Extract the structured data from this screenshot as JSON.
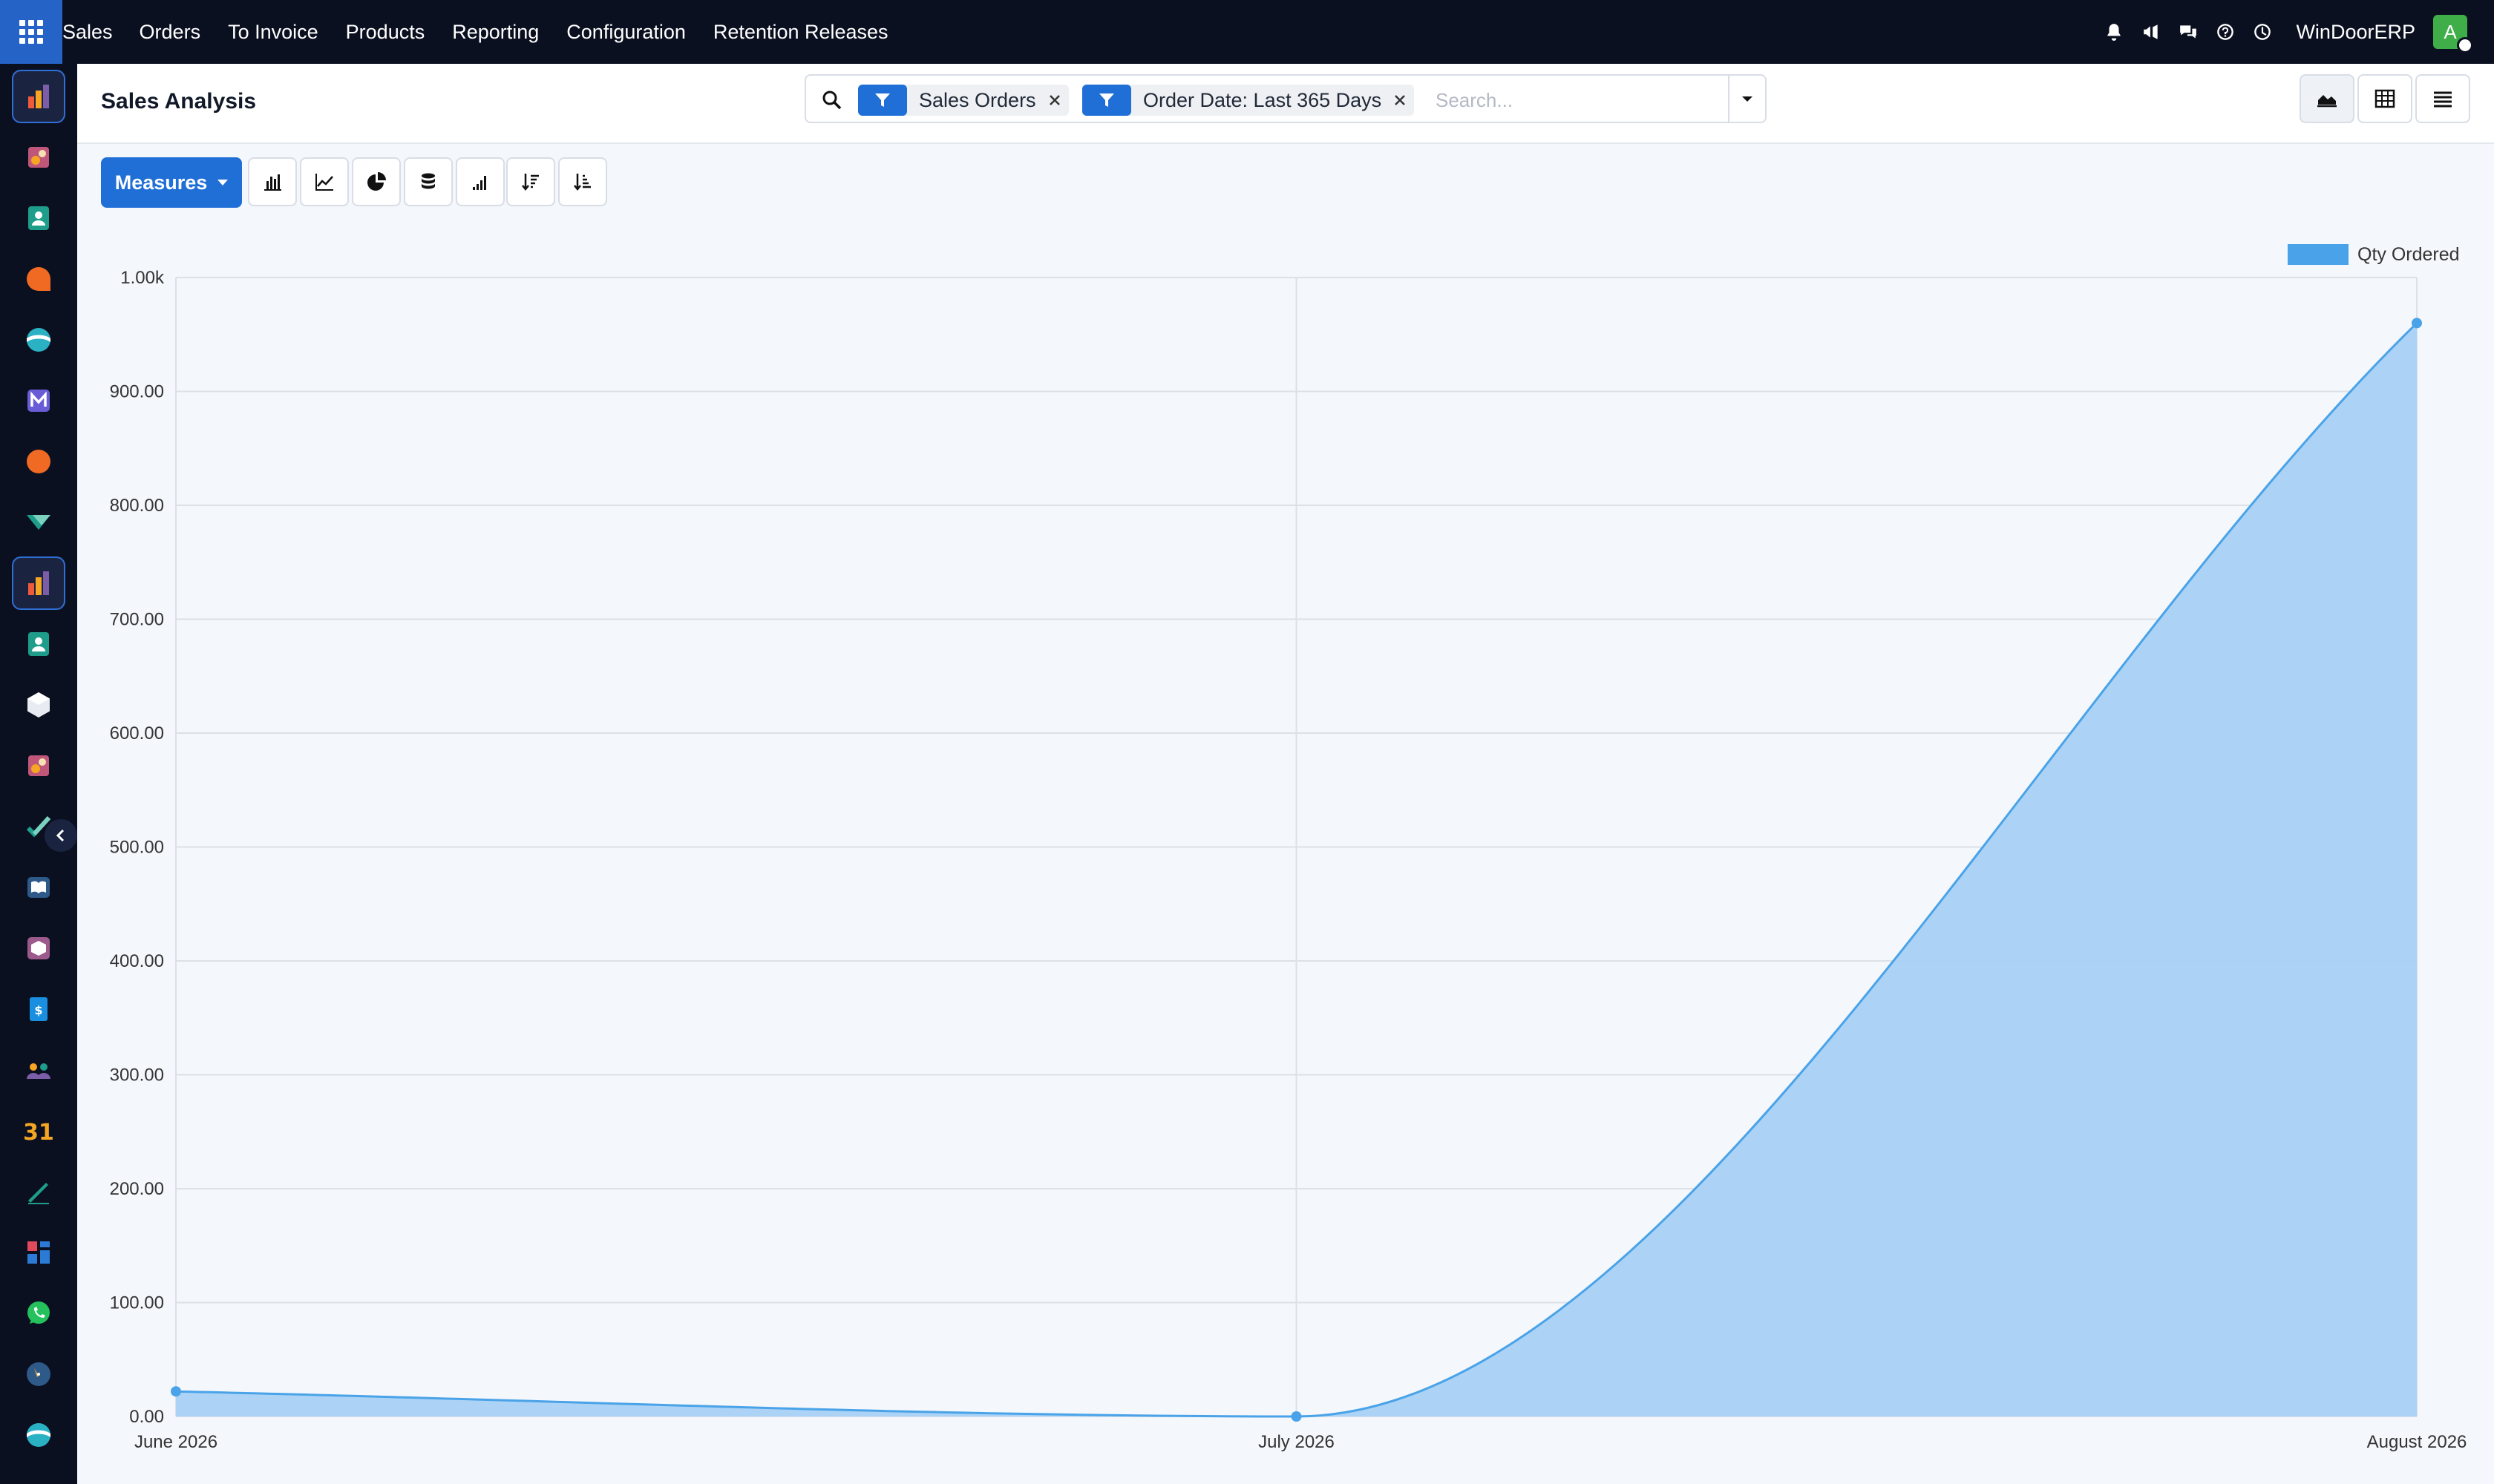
{
  "navbar": {
    "menu": [
      "Sales",
      "Orders",
      "To Invoice",
      "Products",
      "Reporting",
      "Configuration",
      "Retention Releases"
    ],
    "company": "WinDoorERP",
    "avatar_initial": "A"
  },
  "dock": {
    "apps": [
      {
        "icon": "sales-icon",
        "active": true
      },
      {
        "icon": "crm-icon"
      },
      {
        "icon": "contacts-icon"
      },
      {
        "icon": "discuss-icon"
      },
      {
        "icon": "website-icon"
      },
      {
        "icon": "email-marketing-icon"
      },
      {
        "icon": "live-chat-icon"
      },
      {
        "icon": "helpdesk-icon"
      },
      {
        "icon": "sales-icon",
        "active": true
      },
      {
        "icon": "contacts-icon"
      },
      {
        "icon": "inventory-icon"
      },
      {
        "icon": "crm-icon"
      },
      {
        "icon": "project-icon"
      },
      {
        "icon": "knowledge-icon"
      },
      {
        "icon": "purchase-icon"
      },
      {
        "icon": "invoicing-icon"
      },
      {
        "icon": "employees-icon"
      },
      {
        "icon": "calendar-icon"
      },
      {
        "icon": "sign-icon"
      },
      {
        "icon": "dashboards-icon"
      },
      {
        "icon": "whatsapp-icon"
      },
      {
        "icon": "planning-icon"
      },
      {
        "icon": "website-icon"
      }
    ],
    "calendar_day": "31"
  },
  "control_panel": {
    "title": "Sales Analysis",
    "facets": [
      {
        "label": "Sales Orders"
      },
      {
        "label": "Order Date: Last 365 Days"
      }
    ],
    "search_placeholder": "Search..."
  },
  "toolbar": {
    "measures_label": "Measures"
  },
  "colors": {
    "accent": "#1f6fd6",
    "series_line": "#4aa3e8",
    "series_fill": "#a8d1f5"
  },
  "chart_data": {
    "type": "area",
    "x": [
      "June 2026",
      "July 2026",
      "August 2026"
    ],
    "series": [
      {
        "name": "Qty Ordered",
        "values": [
          22,
          0,
          960
        ]
      }
    ],
    "ylim": [
      0,
      1000
    ],
    "yticks": [
      0,
      100,
      200,
      300,
      400,
      500,
      600,
      700,
      800,
      900,
      1000
    ],
    "ytick_labels": [
      "0.00",
      "100.00",
      "200.00",
      "300.00",
      "400.00",
      "500.00",
      "600.00",
      "700.00",
      "800.00",
      "900.00",
      "1.00k"
    ],
    "grid": true,
    "legend": "top-right"
  }
}
